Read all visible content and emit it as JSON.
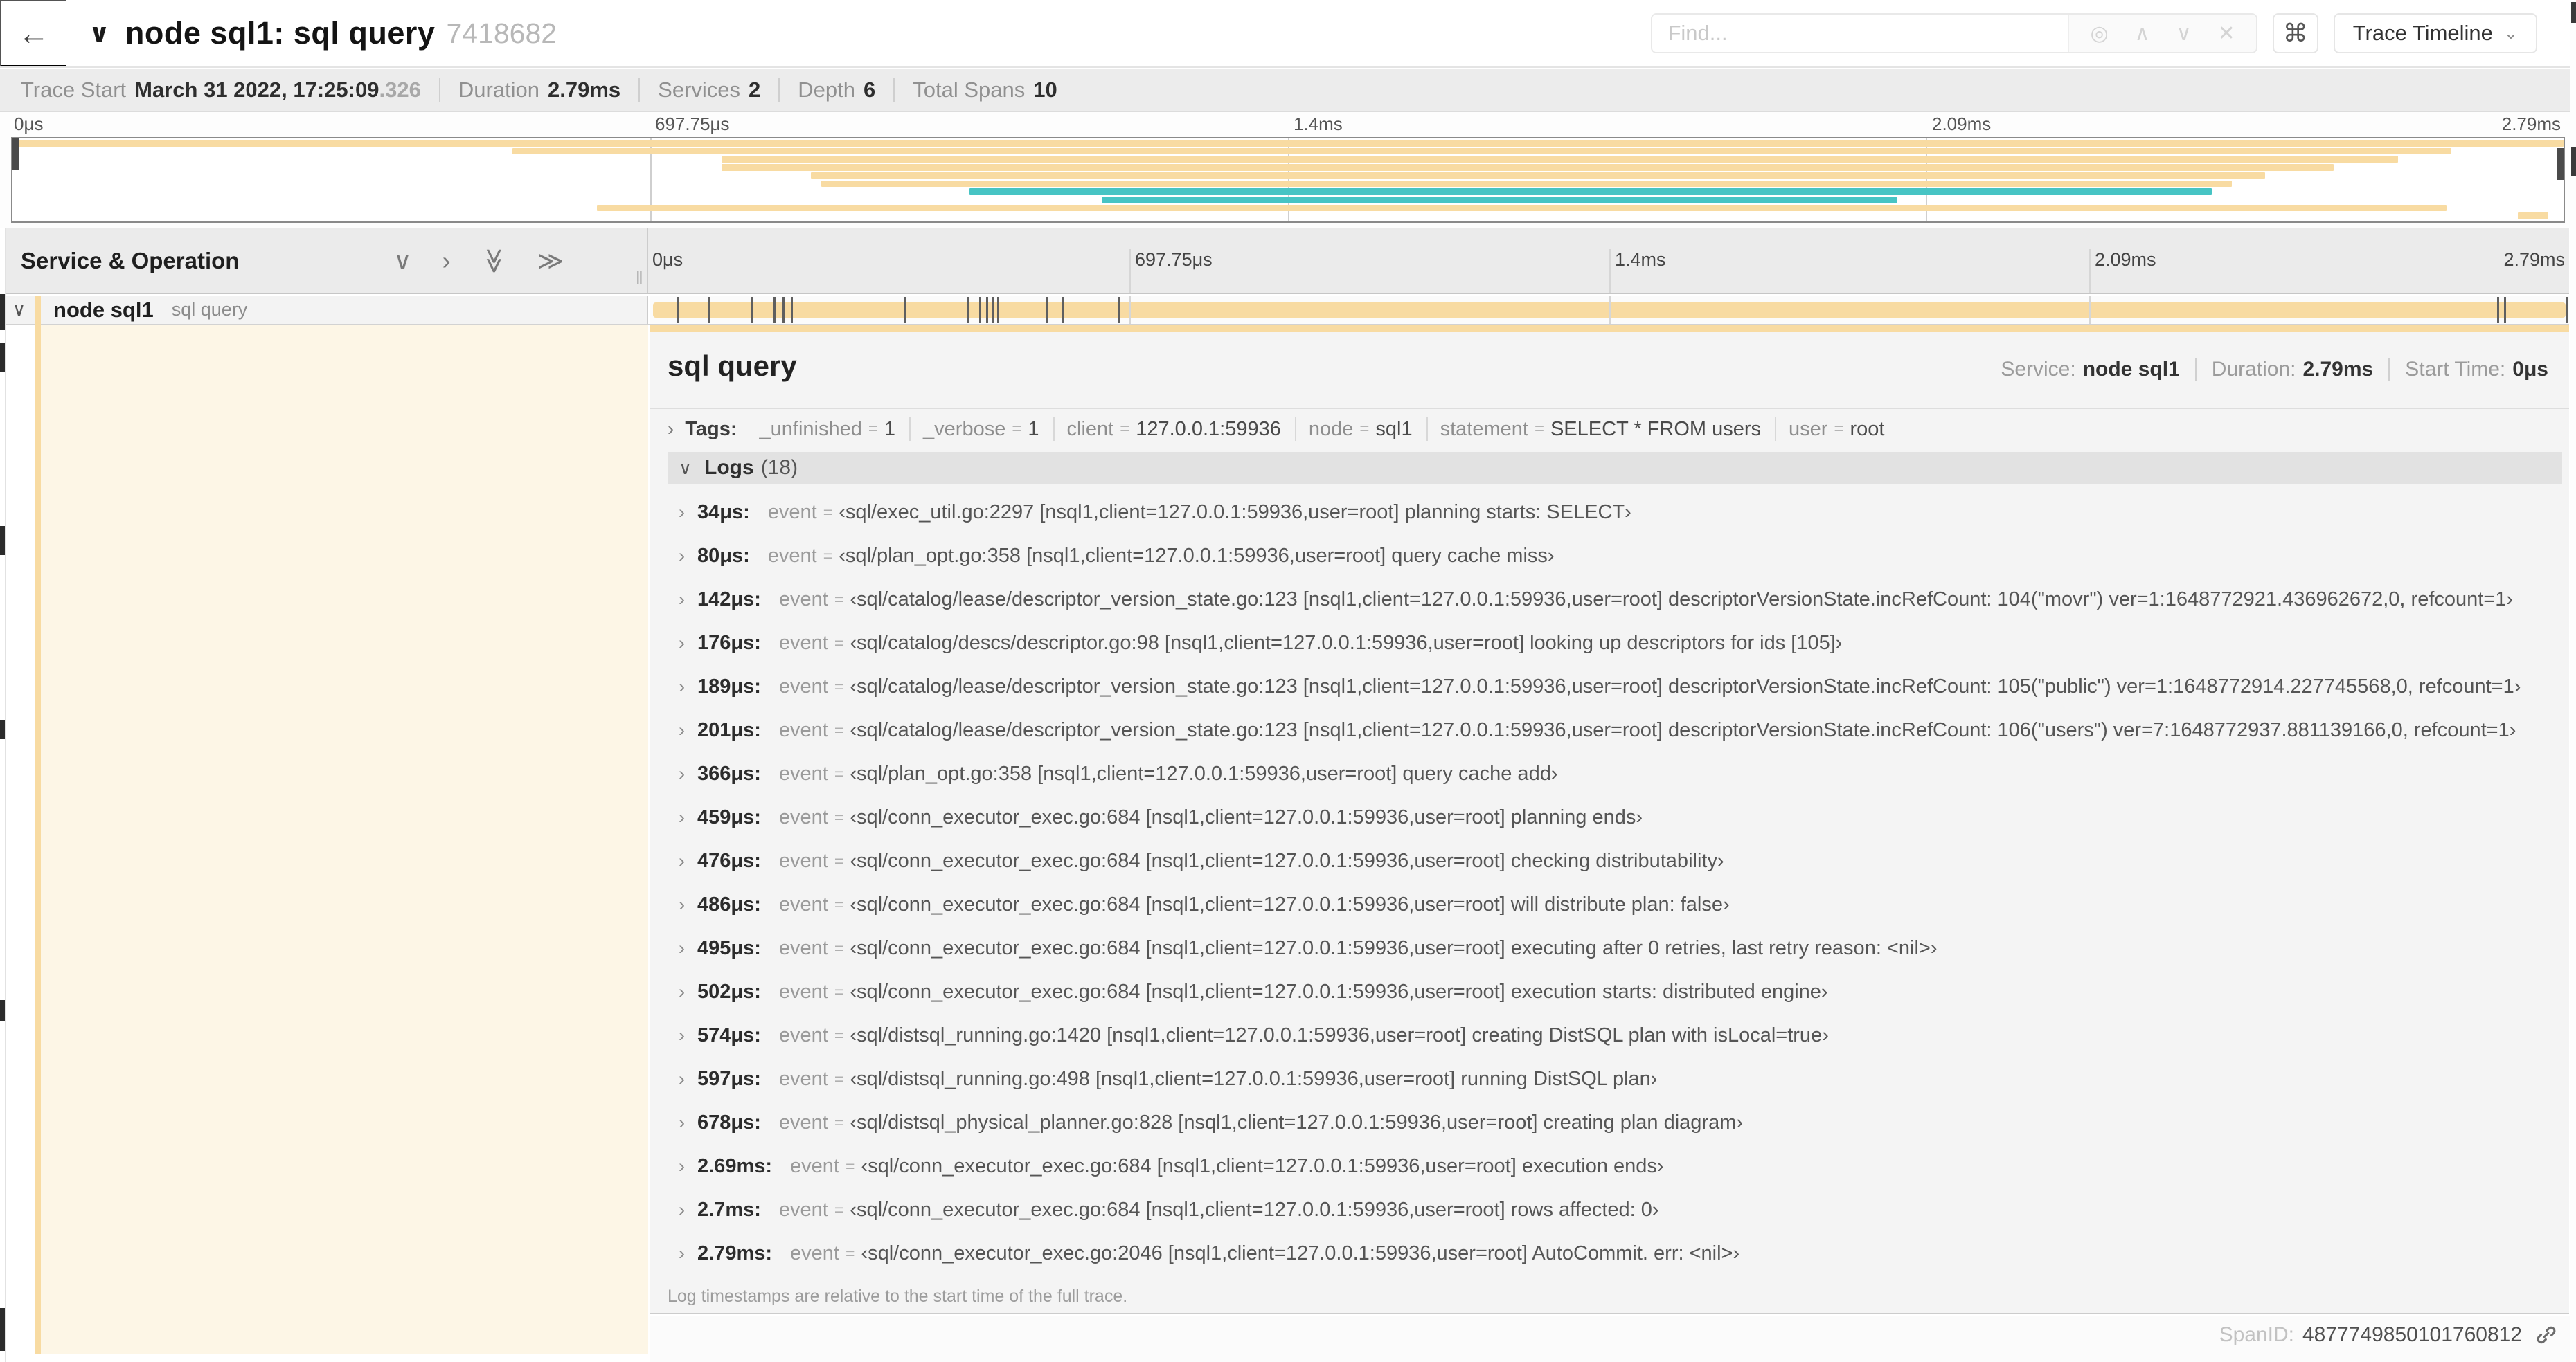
{
  "colors": {
    "tan": "#f8dba2",
    "teal": "#47c4c4",
    "cream": "#fdf6e6"
  },
  "icons": {
    "back": "←",
    "chevron_down": "∨",
    "chevron_right": "›",
    "caret_down": "⌄",
    "keyboard_shortcut": "⌘",
    "locate_target": "◎",
    "up": "∧",
    "down": "∨",
    "close": "✕",
    "double_chevron": "≫"
  },
  "topnav": {
    "title": "node sql1: sql query",
    "trace_id": "7418682",
    "find_placeholder": "Find...",
    "view_selector_label": "Trace Timeline"
  },
  "stats": {
    "items": [
      {
        "label": "Trace Start",
        "value": "March 31 2022, 17:25:09",
        "suffix": ".326"
      },
      {
        "label": "Duration",
        "value": "2.79ms",
        "suffix": ""
      },
      {
        "label": "Services",
        "value": "2",
        "suffix": ""
      },
      {
        "label": "Depth",
        "value": "6",
        "suffix": ""
      },
      {
        "label": "Total Spans",
        "value": "10",
        "suffix": ""
      }
    ]
  },
  "timeline": {
    "ticks": [
      "0μs",
      "697.75μs",
      "1.4ms",
      "2.09ms",
      "2.79ms"
    ],
    "total_us": 2790
  },
  "minimap": {
    "spans": [
      {
        "start": 0,
        "end": 100,
        "color": "tan"
      },
      {
        "start": 19.6,
        "end": 95.6,
        "color": "tan"
      },
      {
        "start": 27.8,
        "end": 93.5,
        "color": "tan"
      },
      {
        "start": 27.8,
        "end": 91.0,
        "color": "tan"
      },
      {
        "start": 31.3,
        "end": 88.3,
        "color": "tan"
      },
      {
        "start": 31.7,
        "end": 87.0,
        "color": "tan"
      },
      {
        "start": 37.5,
        "end": 86.2,
        "color": "teal"
      },
      {
        "start": 42.7,
        "end": 73.9,
        "color": "teal"
      },
      {
        "start": 22.9,
        "end": 95.4,
        "color": "tan"
      },
      {
        "start": 98.2,
        "end": 99.4,
        "color": "tan"
      }
    ]
  },
  "tree_header": {
    "label": "Service & Operation"
  },
  "span_row": {
    "service": "node sql1",
    "operation": "sql query",
    "log_marker_times_us": [
      34,
      80,
      142,
      176,
      189,
      201,
      366,
      459,
      476,
      486,
      495,
      502,
      574,
      597,
      678,
      2690,
      2700,
      2790
    ]
  },
  "detail": {
    "title": "sql query",
    "service_label": "Service:",
    "service": "node sql1",
    "duration_label": "Duration:",
    "duration": "2.79ms",
    "start_label": "Start Time:",
    "start": "0μs",
    "tags": {
      "label": "Tags:",
      "items": [
        {
          "key": "_unfinished",
          "value": "1"
        },
        {
          "key": "_verbose",
          "value": "1"
        },
        {
          "key": "client",
          "value": "127.0.0.1:59936"
        },
        {
          "key": "node",
          "value": "sql1"
        },
        {
          "key": "statement",
          "value": "SELECT * FROM users"
        },
        {
          "key": "user",
          "value": "root"
        }
      ]
    },
    "logs": {
      "label": "Logs",
      "count": "(18)",
      "field_name": "event",
      "entries": [
        {
          "time": "34μs:",
          "value": "‹sql/exec_util.go:2297 [nsql1,client=127.0.0.1:59936,user=root] planning starts: SELECT›"
        },
        {
          "time": "80μs:",
          "value": "‹sql/plan_opt.go:358 [nsql1,client=127.0.0.1:59936,user=root] query cache miss›"
        },
        {
          "time": "142μs:",
          "value": "‹sql/catalog/lease/descriptor_version_state.go:123 [nsql1,client=127.0.0.1:59936,user=root] descriptorVersionState.incRefCount: 104(\"movr\") ver=1:1648772921.436962672,0, refcount=1›"
        },
        {
          "time": "176μs:",
          "value": "‹sql/catalog/descs/descriptor.go:98 [nsql1,client=127.0.0.1:59936,user=root] looking up descriptors for ids [105]›"
        },
        {
          "time": "189μs:",
          "value": "‹sql/catalog/lease/descriptor_version_state.go:123 [nsql1,client=127.0.0.1:59936,user=root] descriptorVersionState.incRefCount: 105(\"public\") ver=1:1648772914.227745568,0, refcount=1›"
        },
        {
          "time": "201μs:",
          "value": "‹sql/catalog/lease/descriptor_version_state.go:123 [nsql1,client=127.0.0.1:59936,user=root] descriptorVersionState.incRefCount: 106(\"users\") ver=7:1648772937.881139166,0, refcount=1›"
        },
        {
          "time": "366μs:",
          "value": "‹sql/plan_opt.go:358 [nsql1,client=127.0.0.1:59936,user=root] query cache add›"
        },
        {
          "time": "459μs:",
          "value": "‹sql/conn_executor_exec.go:684 [nsql1,client=127.0.0.1:59936,user=root] planning ends›"
        },
        {
          "time": "476μs:",
          "value": "‹sql/conn_executor_exec.go:684 [nsql1,client=127.0.0.1:59936,user=root] checking distributability›"
        },
        {
          "time": "486μs:",
          "value": "‹sql/conn_executor_exec.go:684 [nsql1,client=127.0.0.1:59936,user=root] will distribute plan: false›"
        },
        {
          "time": "495μs:",
          "value": "‹sql/conn_executor_exec.go:684 [nsql1,client=127.0.0.1:59936,user=root] executing after 0 retries, last retry reason: <nil>›"
        },
        {
          "time": "502μs:",
          "value": "‹sql/conn_executor_exec.go:684 [nsql1,client=127.0.0.1:59936,user=root] execution starts: distributed engine›"
        },
        {
          "time": "574μs:",
          "value": "‹sql/distsql_running.go:1420 [nsql1,client=127.0.0.1:59936,user=root] creating DistSQL plan with isLocal=true›"
        },
        {
          "time": "597μs:",
          "value": "‹sql/distsql_running.go:498 [nsql1,client=127.0.0.1:59936,user=root] running DistSQL plan›"
        },
        {
          "time": "678μs:",
          "value": "‹sql/distsql_physical_planner.go:828 [nsql1,client=127.0.0.1:59936,user=root] creating plan diagram›"
        },
        {
          "time": "2.69ms:",
          "value": "‹sql/conn_executor_exec.go:684 [nsql1,client=127.0.0.1:59936,user=root] execution ends›"
        },
        {
          "time": "2.7ms:",
          "value": "‹sql/conn_executor_exec.go:684 [nsql1,client=127.0.0.1:59936,user=root] rows affected: 0›"
        },
        {
          "time": "2.79ms:",
          "value": "‹sql/conn_executor_exec.go:2046 [nsql1,client=127.0.0.1:59936,user=root] AutoCommit. err: <nil>›"
        }
      ],
      "note": "Log timestamps are relative to the start time of the full trace."
    },
    "span_id_label": "SpanID:",
    "span_id": "4877749850101760812"
  }
}
